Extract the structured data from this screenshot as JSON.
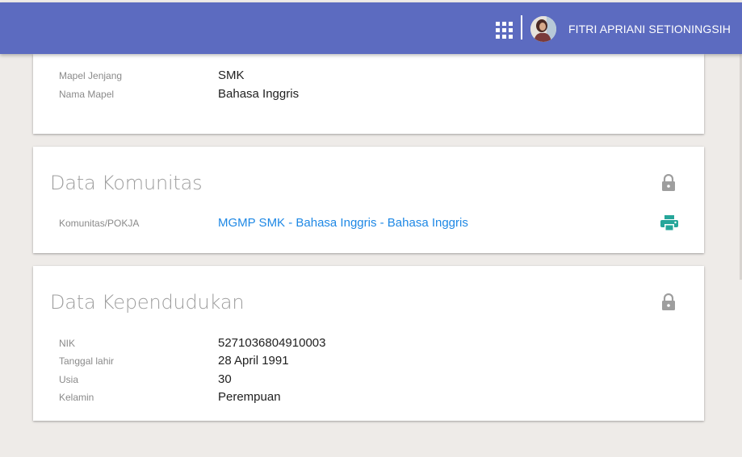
{
  "header": {
    "username": "FITRI APRIANI SETIONINGSIH",
    "brand_color": "#5c6bc0"
  },
  "cards": {
    "mapel": {
      "rows": [
        {
          "label": "Mapel Jenjang",
          "value": "SMK"
        },
        {
          "label": "Nama Mapel",
          "value": "Bahasa Inggris"
        }
      ]
    },
    "komunitas": {
      "title": "Data Komunitas",
      "rows": [
        {
          "label": "Komunitas/POKJA",
          "value": "MGMP SMK - Bahasa Inggris - Bahasa Inggris"
        }
      ],
      "icons": [
        "lock-icon",
        "print-icon"
      ]
    },
    "kependudukan": {
      "title": "Data Kependudukan",
      "rows": [
        {
          "label": "NIK",
          "value": "5271036804910003"
        },
        {
          "label": "Tanggal lahir",
          "value": "28 April 1991"
        },
        {
          "label": "Usia",
          "value": "30"
        },
        {
          "label": "Kelamin",
          "value": "Perempuan"
        }
      ],
      "icons": [
        "lock-icon"
      ]
    }
  },
  "colors": {
    "background": "#eeebe8",
    "link": "#1e88e5",
    "print_icon": "#26a69a",
    "lock_icon": "#9e9e9e"
  }
}
